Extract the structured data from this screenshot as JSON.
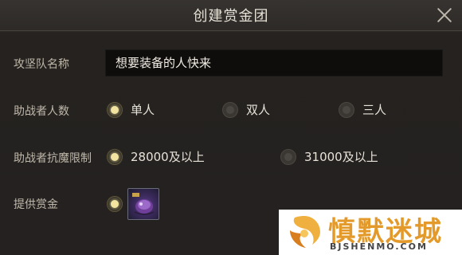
{
  "dialog": {
    "title": "创建赏金团",
    "close_icon": "close-icon"
  },
  "team_name": {
    "label": "攻坚队名称",
    "value": "想要装备的人快来"
  },
  "helper_count": {
    "label": "助战者人数",
    "options": [
      {
        "label": "单人",
        "selected": true
      },
      {
        "label": "双人",
        "selected": false
      },
      {
        "label": "三人",
        "selected": false
      }
    ]
  },
  "helper_limit": {
    "label": "助战者抗魔限制",
    "options": [
      {
        "label": "28000及以上",
        "selected": true
      },
      {
        "label": "31000及以上",
        "selected": false
      }
    ]
  },
  "reward": {
    "label": "提供赏金",
    "selected": true,
    "item_icon": "reward-item-icon"
  },
  "watermark": {
    "name": "慎默迷城",
    "url": "BJSHENMO.COM"
  },
  "colors": {
    "accent": "#f3e3a0",
    "background": "#252220",
    "input_bg": "#0e0d0c"
  }
}
